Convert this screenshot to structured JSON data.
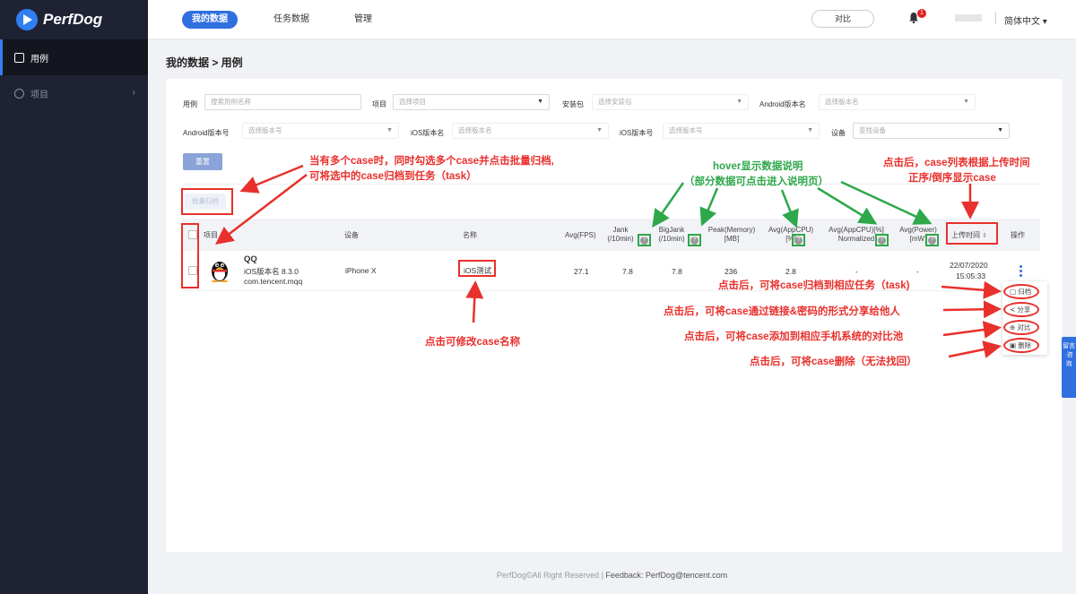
{
  "app": {
    "logo_text": "PerfDog"
  },
  "sidebar": {
    "items": [
      {
        "label": "用例",
        "icon": "case-list-icon"
      },
      {
        "label": "项目",
        "icon": "layers-icon"
      }
    ]
  },
  "topnav": {
    "tabs": [
      "我的数据",
      "任务数据",
      "管理"
    ],
    "compare_button": "对比",
    "notification_count": "1",
    "language": "简体中文"
  },
  "breadcrumb": "我的数据 > 用例",
  "filters": {
    "case_label": "用例",
    "case_placeholder": "搜索用例名称",
    "project_label": "项目",
    "project_placeholder": "选择项目",
    "package_label": "安装包",
    "package_placeholder": "选择安装包",
    "android_ver_name_label": "Android版本名",
    "android_ver_name_placeholder": "选择版本名",
    "android_ver_num_label": "Android版本号",
    "android_ver_num_placeholder": "选择版本号",
    "ios_ver_name_label": "iOS版本名",
    "ios_ver_name_placeholder": "选择版本名",
    "ios_ver_num_label": "iOS版本号",
    "ios_ver_num_placeholder": "选择版本号",
    "device_label": "设备",
    "device_placeholder": "查找设备",
    "reset_button": "重置",
    "batch_archive_button": "批量归档"
  },
  "table": {
    "headers": {
      "project": "项目",
      "device": "设备",
      "name": "名称",
      "fps": "Avg(FPS)",
      "jank_1": "Jank",
      "jank_2": "(/10min)",
      "bigjank_1": "BigJank",
      "bigjank_2": "(/10min)",
      "memory_1": "Peak(Memory)",
      "memory_2": "[MB]",
      "appcpu_1": "Avg(AppCPU)",
      "appcpu_2": "[%]",
      "appcpu_norm_1": "Avg(AppCPU)[%]",
      "appcpu_norm_2": "Normalized",
      "power_1": "Avg(Power)",
      "power_2": "[mW]",
      "upload_time": "上传时间",
      "actions": "操作"
    },
    "rows": [
      {
        "app_name": "QQ",
        "app_version": "iOS版本名 8.3.0",
        "bundle": "com.tencent.mqq",
        "device": "iPhone X",
        "case_name": "iOS测试",
        "fps": "27.1",
        "jank": "7.8",
        "bigjank": "7.8",
        "memory": "236",
        "appcpu": "2.8",
        "appcpu_norm": "-",
        "power": "-",
        "upload_date": "22/07/2020",
        "upload_time": "15:05:33"
      }
    ]
  },
  "action_menu": [
    "归档",
    "分享",
    "对比",
    "删除"
  ],
  "annotations": {
    "batch_1": "当有多个case时，同时勾选多个case并点击批量归档,",
    "batch_2": "可将选中的case归档到任务（task）",
    "hover_1": "hover显示数据说明",
    "hover_2": "（部分数据可点击进入说明页）",
    "sort_1": "点击后，case列表根据上传时间",
    "sort_2": "正序/倒序显示case",
    "rename": "点击可修改case名称",
    "archive": "点击后，可将case归档到相应任务（task)",
    "share": "点击后，可将case通过链接&密码的形式分享给他人",
    "compare": "点击后，可将case添加到相应手机系统的对比池",
    "delete": "点击后，可将case删除（无法找回）"
  },
  "feedback_tab": "留言·咨询",
  "footer": {
    "copyright": "PerfDog©All Right Reserved",
    "feedback": "Feedback: PerfDog@tencent.com"
  },
  "colors": {
    "sidebar_bg": "#1f2233",
    "accent": "#2f6fe0",
    "annotation_red": "#e8302c",
    "annotation_green": "#2ea84a"
  }
}
